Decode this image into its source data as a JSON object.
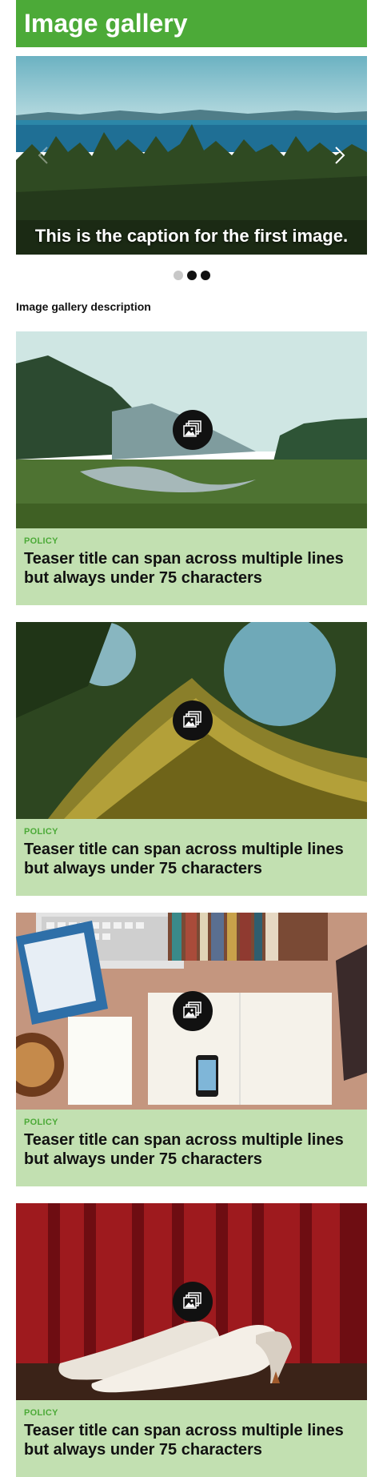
{
  "page": {
    "title": "Image gallery"
  },
  "carousel": {
    "caption": "This is the caption for the first image.",
    "slides": 3,
    "active_slide": 2
  },
  "description": "Image gallery description",
  "cards": [
    {
      "category": "POLICY",
      "title": "Teaser title can span across multiple lines but always under 75 characters",
      "image": "mountain-river-landscape"
    },
    {
      "category": "POLICY",
      "title": "Teaser title can span across multiple lines but always under 75 characters",
      "image": "mossy-tree-trunk"
    },
    {
      "category": "POLICY",
      "title": "Teaser title can span across multiple lines but always under 75 characters",
      "image": "desk-with-books-and-phone"
    },
    {
      "category": "POLICY",
      "title": "Teaser title can span across multiple lines but always under 75 characters",
      "image": "white-high-heels-on-red-wood"
    }
  ],
  "colors": {
    "brand": "#4caa38",
    "card_bg": "#c2e0b1",
    "icon_bg": "#111111"
  },
  "icons": [
    "chevron-left-icon",
    "chevron-right-icon",
    "gallery-icon"
  ]
}
